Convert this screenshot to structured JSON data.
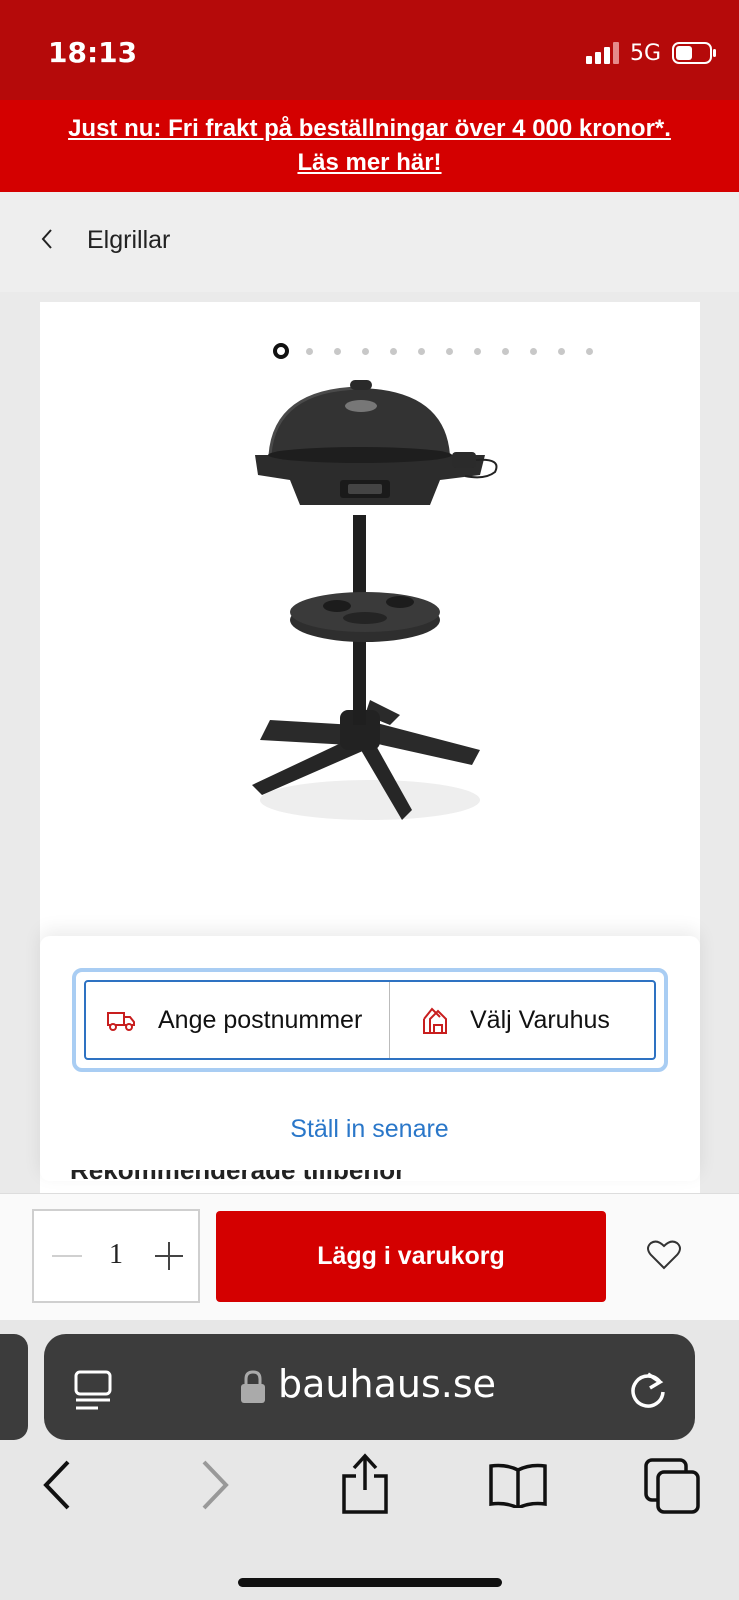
{
  "status_bar": {
    "time": "18:13",
    "network": "5G"
  },
  "promo": {
    "line1": "Just nu: Fri frakt på beställningar över 4 000 kronor*.",
    "line2": "Läs mer här!"
  },
  "breadcrumb": {
    "label": "Elgrillar"
  },
  "gallery": {
    "dot_count": 12,
    "active_index": 0
  },
  "delivery": {
    "postcode_label": "Ange postnummer",
    "store_label": "Välj Varuhus",
    "later_label": "Ställ in senare"
  },
  "section": {
    "heading": "Rekommenderade tillbehör"
  },
  "cart": {
    "quantity": "1",
    "add_label": "Lägg i varukorg"
  },
  "browser": {
    "url": "bauhaus.se"
  },
  "colors": {
    "brand_red": "#d40000",
    "status_red": "#b50a0a",
    "link_blue": "#2a77c9"
  }
}
